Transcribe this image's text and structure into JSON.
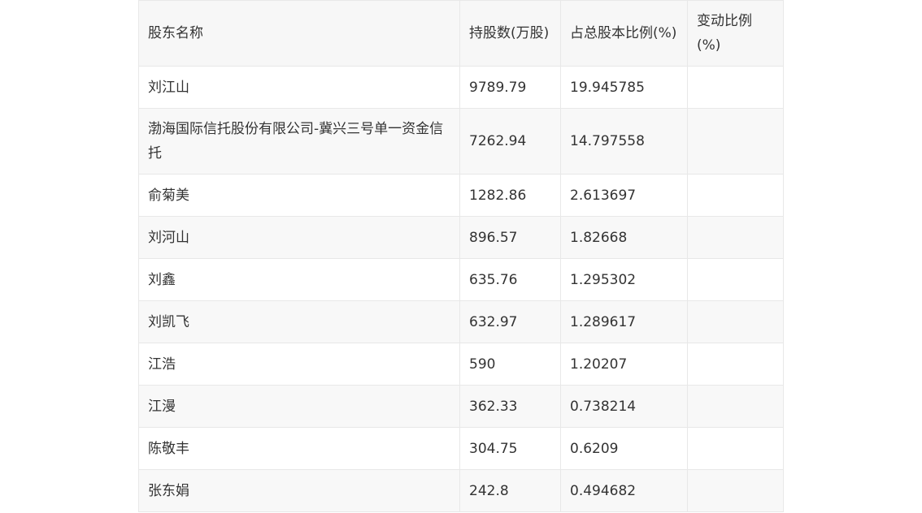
{
  "table": {
    "headers": [
      "股东名称",
      "持股数(万股)",
      "占总股本比例(%)",
      "变动比例(%)"
    ],
    "rows": [
      {
        "name": "刘江山",
        "shares": "9789.79",
        "ratio": "19.945785",
        "change": ""
      },
      {
        "name": "渤海国际信托股份有限公司-冀兴三号单一资金信托",
        "shares": "7262.94",
        "ratio": "14.797558",
        "change": ""
      },
      {
        "name": "俞菊美",
        "shares": "1282.86",
        "ratio": "2.613697",
        "change": ""
      },
      {
        "name": "刘河山",
        "shares": "896.57",
        "ratio": "1.82668",
        "change": ""
      },
      {
        "name": "刘鑫",
        "shares": "635.76",
        "ratio": "1.295302",
        "change": ""
      },
      {
        "name": "刘凯飞",
        "shares": "632.97",
        "ratio": "1.289617",
        "change": ""
      },
      {
        "name": "江浩",
        "shares": "590",
        "ratio": "1.20207",
        "change": ""
      },
      {
        "name": "江漫",
        "shares": "362.33",
        "ratio": "0.738214",
        "change": ""
      },
      {
        "name": "陈敬丰",
        "shares": "304.75",
        "ratio": "0.6209",
        "change": ""
      },
      {
        "name": "张东娟",
        "shares": "242.8",
        "ratio": "0.494682",
        "change": ""
      }
    ]
  }
}
